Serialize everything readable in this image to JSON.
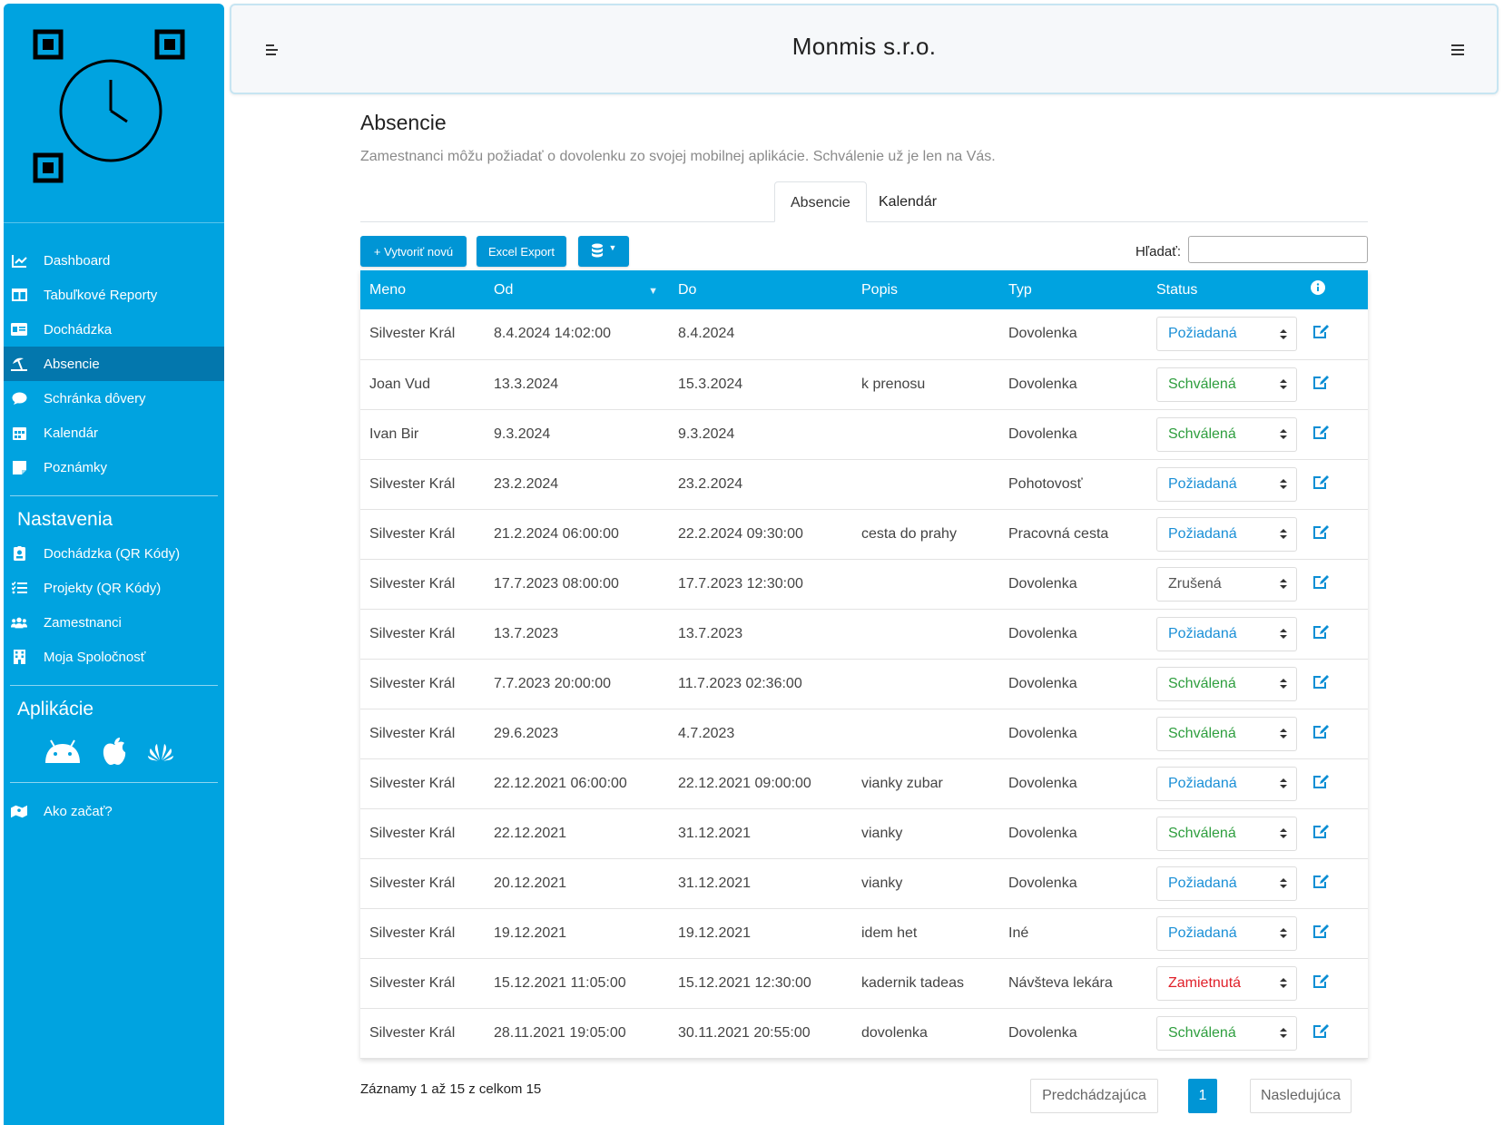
{
  "header": {
    "title": "Monmis s.r.o."
  },
  "sidebar": {
    "items": [
      {
        "label": "Dashboard",
        "icon": "chart-line-icon"
      },
      {
        "label": "Tabuľkové Reporty",
        "icon": "table-icon"
      },
      {
        "label": "Dochádzka",
        "icon": "id-card-icon"
      },
      {
        "label": "Absencie",
        "icon": "umbrella-beach-icon",
        "active": true
      },
      {
        "label": "Schránka dôvery",
        "icon": "comment-icon"
      },
      {
        "label": "Kalendár",
        "icon": "calendar-icon"
      },
      {
        "label": "Poznámky",
        "icon": "sticky-note-icon"
      }
    ],
    "settings_heading": "Nastavenia",
    "settings_items": [
      {
        "label": "Dochádzka (QR Kódy)",
        "icon": "id-badge-icon"
      },
      {
        "label": "Projekty (QR Kódy)",
        "icon": "tasks-icon"
      },
      {
        "label": "Zamestnanci",
        "icon": "users-icon"
      },
      {
        "label": "Moja Spoločnosť",
        "icon": "building-icon"
      }
    ],
    "apps_heading": "Aplikácie",
    "apps": [
      "android-icon",
      "apple-icon",
      "huawei-icon"
    ],
    "help_item": {
      "label": "Ako začať?",
      "icon": "map-icon"
    }
  },
  "page": {
    "title": "Absencie",
    "subtitle": "Zamestnanci môžu požiadať o dovolenku zo svojej mobilnej aplikácie. Schválenie už je len na Vás.",
    "tabs": [
      {
        "label": "Absencie",
        "active": true
      },
      {
        "label": "Kalendár",
        "active": false
      }
    ]
  },
  "toolbar": {
    "create_label": "+ Vytvoriť novú",
    "excel_label": "Excel Export",
    "search_label": "Hľadať:",
    "search_value": ""
  },
  "table": {
    "columns": [
      "Meno",
      "Od",
      "Do",
      "Popis",
      "Typ",
      "Status"
    ],
    "rows": [
      {
        "meno": "Silvester Král",
        "od": "8.4.2024 14:02:00",
        "do": "8.4.2024",
        "popis": "",
        "typ": "Dovolenka",
        "status": "Požiadaná"
      },
      {
        "meno": "Joan Vud",
        "od": "13.3.2024",
        "do": "15.3.2024",
        "popis": "k prenosu",
        "typ": "Dovolenka",
        "status": "Schválená"
      },
      {
        "meno": "Ivan Bir",
        "od": "9.3.2024",
        "do": "9.3.2024",
        "popis": "",
        "typ": "Dovolenka",
        "status": "Schválená"
      },
      {
        "meno": "Silvester Král",
        "od": "23.2.2024",
        "do": "23.2.2024",
        "popis": "",
        "typ": "Pohotovosť",
        "status": "Požiadaná"
      },
      {
        "meno": "Silvester Král",
        "od": "21.2.2024 06:00:00",
        "do": "22.2.2024 09:30:00",
        "popis": "cesta do prahy",
        "typ": "Pracovná cesta",
        "status": "Požiadaná"
      },
      {
        "meno": "Silvester Král",
        "od": "17.7.2023 08:00:00",
        "do": "17.7.2023 12:30:00",
        "popis": "",
        "typ": "Dovolenka",
        "status": "Zrušená"
      },
      {
        "meno": "Silvester Král",
        "od": "13.7.2023",
        "do": "13.7.2023",
        "popis": "",
        "typ": "Dovolenka",
        "status": "Požiadaná"
      },
      {
        "meno": "Silvester Král",
        "od": "7.7.2023 20:00:00",
        "do": "11.7.2023 02:36:00",
        "popis": "",
        "typ": "Dovolenka",
        "status": "Schválená"
      },
      {
        "meno": "Silvester Král",
        "od": "29.6.2023",
        "do": "4.7.2023",
        "popis": "",
        "typ": "Dovolenka",
        "status": "Schválená"
      },
      {
        "meno": "Silvester Král",
        "od": "22.12.2021 06:00:00",
        "do": "22.12.2021 09:00:00",
        "popis": "vianky zubar",
        "typ": "Dovolenka",
        "status": "Požiadaná"
      },
      {
        "meno": "Silvester Král",
        "od": "22.12.2021",
        "do": "31.12.2021",
        "popis": "vianky",
        "typ": "Dovolenka",
        "status": "Schválená"
      },
      {
        "meno": "Silvester Král",
        "od": "20.12.2021",
        "do": "31.12.2021",
        "popis": "vianky",
        "typ": "Dovolenka",
        "status": "Požiadaná"
      },
      {
        "meno": "Silvester Král",
        "od": "19.12.2021",
        "do": "19.12.2021",
        "popis": "idem het",
        "typ": "Iné",
        "status": "Požiadaná"
      },
      {
        "meno": "Silvester Král",
        "od": "15.12.2021 11:05:00",
        "do": "15.12.2021 12:30:00",
        "popis": "kadernik tadeas",
        "typ": "Návšteva lekára",
        "status": "Zamietnutá"
      },
      {
        "meno": "Silvester Král",
        "od": "28.11.2021 19:05:00",
        "do": "30.11.2021 20:55:00",
        "popis": "dovolenka",
        "typ": "Dovolenka",
        "status": "Schválená"
      }
    ]
  },
  "status_colors": {
    "Požiadaná": "#1a8fd6",
    "Schválená": "#2e9e3e",
    "Zrušená": "#555555",
    "Zamietnutá": "#e0202a"
  },
  "pagination": {
    "info": "Záznamy 1 až 15 z celkom 15",
    "prev_label": "Predchádzajúca",
    "current": "1",
    "next_label": "Nasledujúca"
  },
  "colors": {
    "brand": "#00a3e0",
    "sidebar_active": "#0377ad",
    "button": "#0095d5"
  }
}
